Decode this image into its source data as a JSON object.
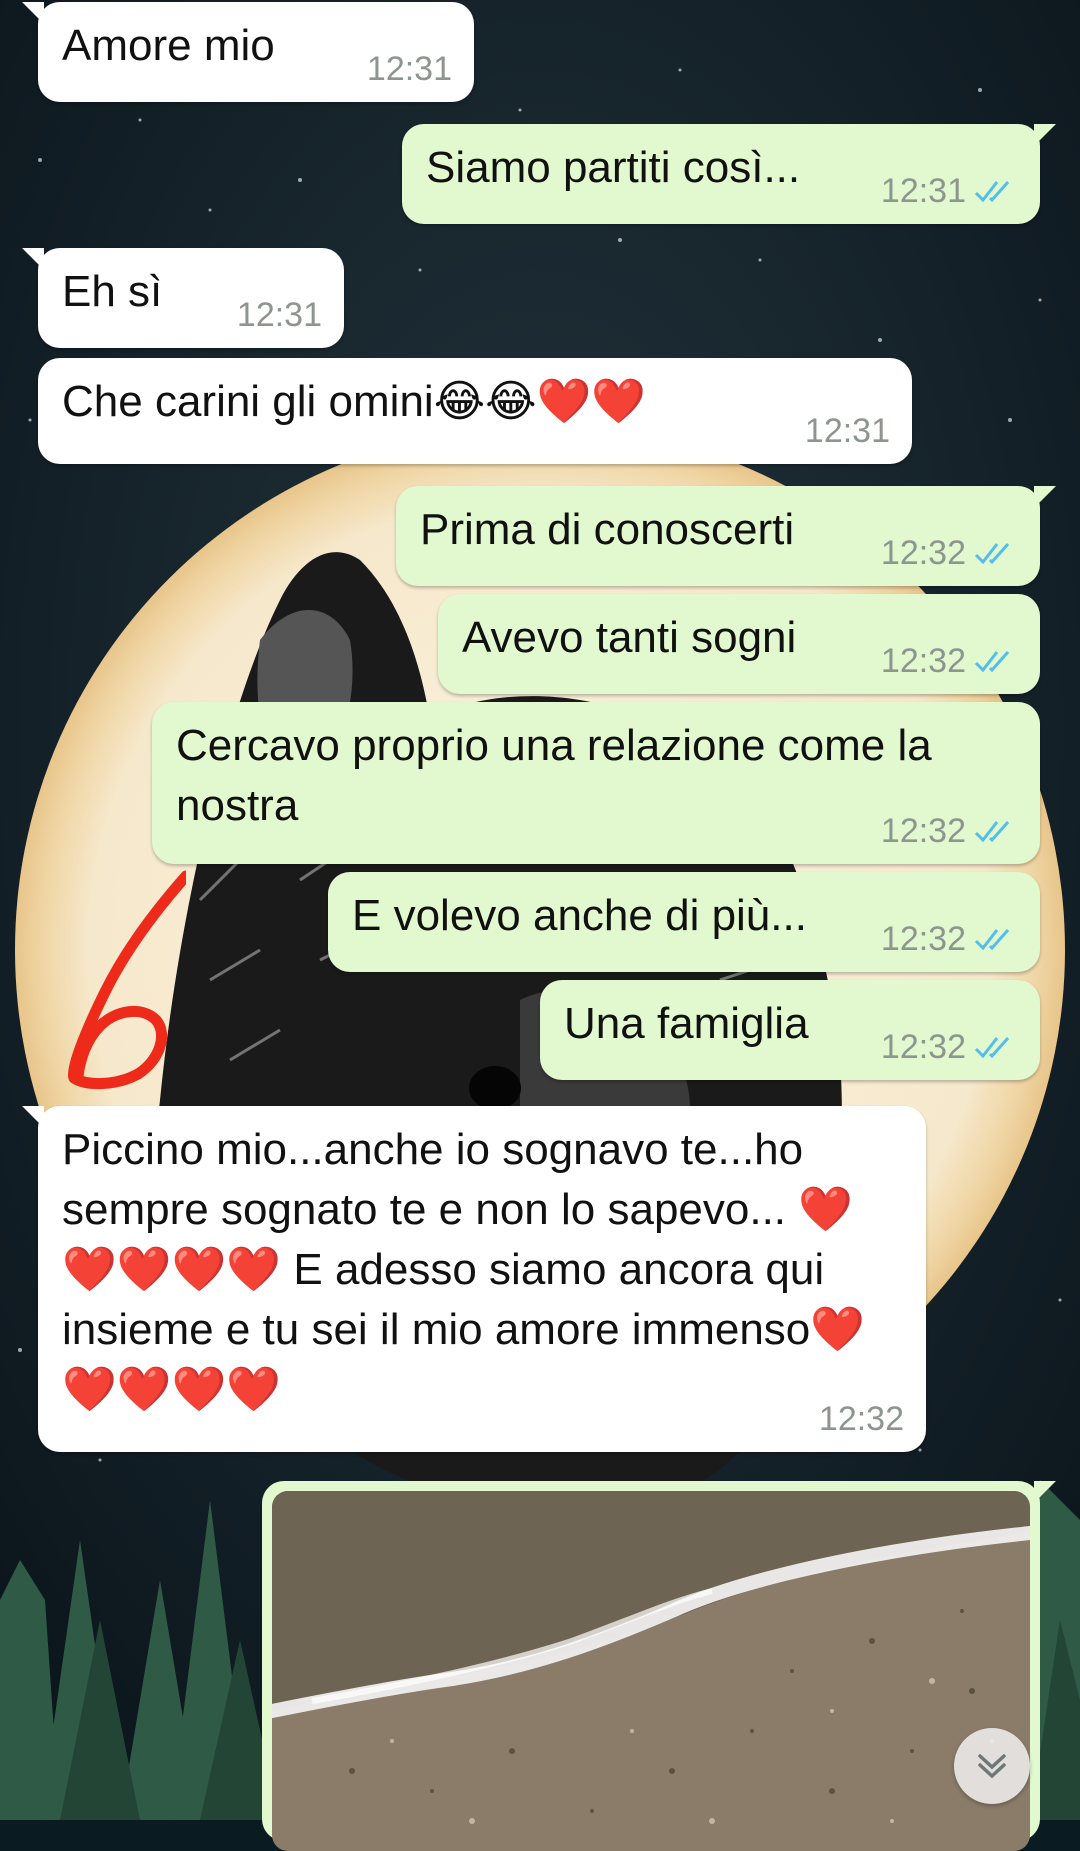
{
  "chat": {
    "messages": [
      {
        "id": "m1",
        "direction": "incoming",
        "text": "Amore mio",
        "time": "12:31"
      },
      {
        "id": "m2",
        "direction": "outgoing",
        "text": "Siamo partiti così...",
        "time": "12:31",
        "status": "read"
      },
      {
        "id": "m3",
        "direction": "incoming",
        "text": "Eh sì",
        "time": "12:31"
      },
      {
        "id": "m4",
        "direction": "incoming",
        "text": "Che carini gli omini😂😂❤️❤️",
        "time": "12:31"
      },
      {
        "id": "m5",
        "direction": "outgoing",
        "text": "Prima di conoscerti",
        "time": "12:32",
        "status": "read"
      },
      {
        "id": "m6",
        "direction": "outgoing",
        "text": "Avevo tanti sogni",
        "time": "12:32",
        "status": "read"
      },
      {
        "id": "m7",
        "direction": "outgoing",
        "text": "Cercavo proprio una relazione come la nostra",
        "time": "12:32",
        "status": "read"
      },
      {
        "id": "m8",
        "direction": "outgoing",
        "text": "E volevo anche di più...",
        "time": "12:32",
        "status": "read"
      },
      {
        "id": "m9",
        "direction": "outgoing",
        "text": "Una famiglia",
        "time": "12:32",
        "status": "read"
      },
      {
        "id": "m10",
        "direction": "incoming",
        "text": "Piccino mio...anche io sognavo te...ho sempre sognato te e non lo sapevo... ❤️❤️❤️❤️❤️ E adesso siamo ancora qui insieme e tu sei il mio amore immenso❤️❤️❤️❤️❤️",
        "time": "12:32"
      },
      {
        "id": "m11",
        "direction": "outgoing",
        "type": "photo",
        "subject": "beach sand with waves"
      }
    ]
  },
  "annotation": {
    "text": "6",
    "color": "#ee2a1a"
  },
  "colors": {
    "incoming_bg": "#ffffff",
    "outgoing_bg": "#e2f8cf",
    "tick_read": "#53bdeb",
    "time_text": "#8d958f"
  },
  "icons": {
    "read_receipt": "double-check-icon",
    "scroll_down": "chevron-down-icon"
  }
}
